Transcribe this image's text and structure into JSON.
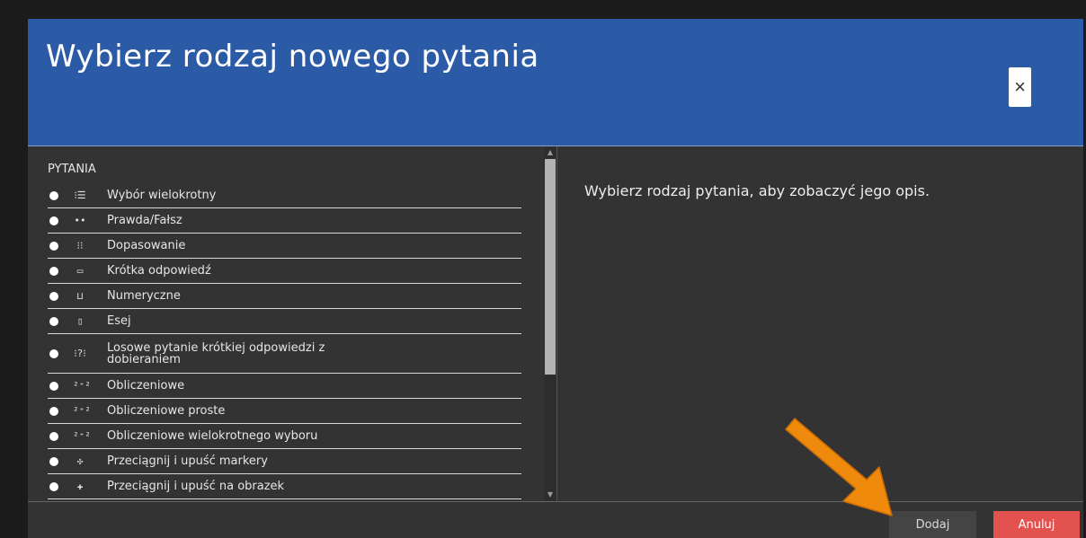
{
  "dialog": {
    "title": "Wybierz rodzaj nowego pytania",
    "close_icon": "×"
  },
  "questions": {
    "section_label": "PYTANIA",
    "items": [
      {
        "label": "Wybór wielokrotny",
        "icon": "multichoice-icon",
        "glyph": "⁝☰"
      },
      {
        "label": "Prawda/Fałsz",
        "icon": "truefalse-icon",
        "glyph": "••"
      },
      {
        "label": "Dopasowanie",
        "icon": "match-icon",
        "glyph": "⁝⁝"
      },
      {
        "label": "Krótka odpowiedź",
        "icon": "shortanswer-icon",
        "glyph": "▭"
      },
      {
        "label": "Numeryczne",
        "icon": "numerical-icon",
        "glyph": "⊔"
      },
      {
        "label": "Esej",
        "icon": "essay-icon",
        "glyph": "▯"
      },
      {
        "label": "Losowe pytanie krótkiej odpowiedzi z dobieraniem",
        "icon": "randomsamatch-icon",
        "glyph": "⁝?⁝"
      },
      {
        "label": "Obliczeniowe",
        "icon": "calculated-icon",
        "glyph": "²⁺²"
      },
      {
        "label": "Obliczeniowe proste",
        "icon": "calculatedsimple-icon",
        "glyph": "²⁺²"
      },
      {
        "label": "Obliczeniowe wielokrotnego wyboru",
        "icon": "calculatedmulti-icon",
        "glyph": "²⁺²"
      },
      {
        "label": "Przeciągnij i upuść markery",
        "icon": "ddmarker-icon",
        "glyph": "✣"
      },
      {
        "label": "Przeciągnij i upuść na obrazek",
        "icon": "ddimageortext-icon",
        "glyph": "✚"
      }
    ]
  },
  "description": {
    "text": "Wybierz rodzaj pytania, aby zobaczyć jego opis."
  },
  "footer": {
    "add_label": "Dodaj",
    "cancel_label": "Anuluj"
  },
  "colors": {
    "header": "#2b5ba6",
    "body": "#333333",
    "cancel": "#e2534f",
    "arrow": "#f08a0c"
  }
}
